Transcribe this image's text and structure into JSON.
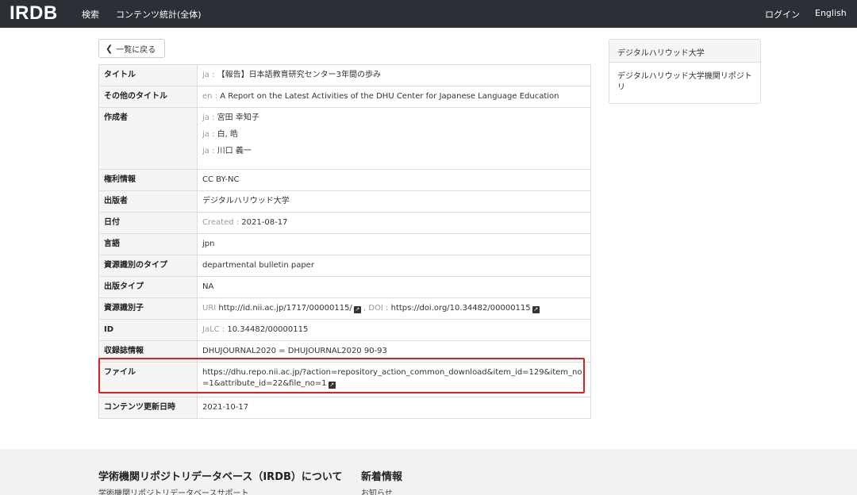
{
  "navbar": {
    "brand": "IRDB",
    "search": "検索",
    "stats": "コンテンツ統計(全体)",
    "login": "ログイン",
    "language": "English"
  },
  "back_button": {
    "label": "一覧に戻る"
  },
  "record": {
    "title": {
      "label": "タイトル",
      "lang": "ja :",
      "value": "【報告】日本語教育研究センター3年間の歩み"
    },
    "alt_title": {
      "label": "その他のタイトル",
      "lang": "en :",
      "value": "A Report on the Latest Activities of the DHU Center for Japanese Language Education"
    },
    "creators": {
      "label": "作成者",
      "items": [
        {
          "lang": "ja :",
          "name": "宮田 幸知子"
        },
        {
          "lang": "ja :",
          "name": "白, 皓"
        },
        {
          "lang": "ja :",
          "name": "川口 義一"
        }
      ]
    },
    "rights": {
      "label": "権利情報",
      "value": "CC BY-NC"
    },
    "publisher": {
      "label": "出版者",
      "value": "デジタルハリウッド大学"
    },
    "date": {
      "label": "日付",
      "prefix": "Created :",
      "value": "2021-08-17"
    },
    "language": {
      "label": "言語",
      "value": "jpn"
    },
    "resource_type": {
      "label": "資源識別のタイプ",
      "value": "departmental bulletin paper"
    },
    "publication_type": {
      "label": "出版タイプ",
      "value": "NA"
    },
    "identifier": {
      "label": "資源識別子",
      "uri_prefix": "URI",
      "uri": "http://id.nii.ac.jp/1717/00000115/",
      "doi_prefix": ", DOI :",
      "doi": "https://doi.org/10.34482/00000115"
    },
    "id": {
      "label": "ID",
      "prefix": "JaLC :",
      "value": "10.34482/00000115"
    },
    "journal": {
      "label": "収録誌情報",
      "value": "DHUJOURNAL2020 = DHUJOURNAL2020 90-93"
    },
    "file": {
      "label": "ファイル",
      "url": "https://dhu.repo.nii.ac.jp/?action=repository_action_common_download&item_id=129&item_no=1&attribute_id=22&file_no=1"
    },
    "updated": {
      "label": "コンテンツ更新日時",
      "value": "2021-10-17"
    }
  },
  "side_panel": {
    "heading": "デジタルハリウッド大学",
    "link": "デジタルハリウッド大学機関リポジトリ"
  },
  "footer": {
    "about_heading": "学術機関リポジトリデータベース（IRDB）について",
    "about_link": "学術機関リポジトリデータベースサポート",
    "news_heading": "新着情報",
    "news_link": "お知らせ"
  },
  "colors": {
    "navbar": "#2b2f36",
    "highlight": "#e02020"
  },
  "icons": {
    "back": "chevron-left-icon",
    "external": "external-link-icon"
  }
}
